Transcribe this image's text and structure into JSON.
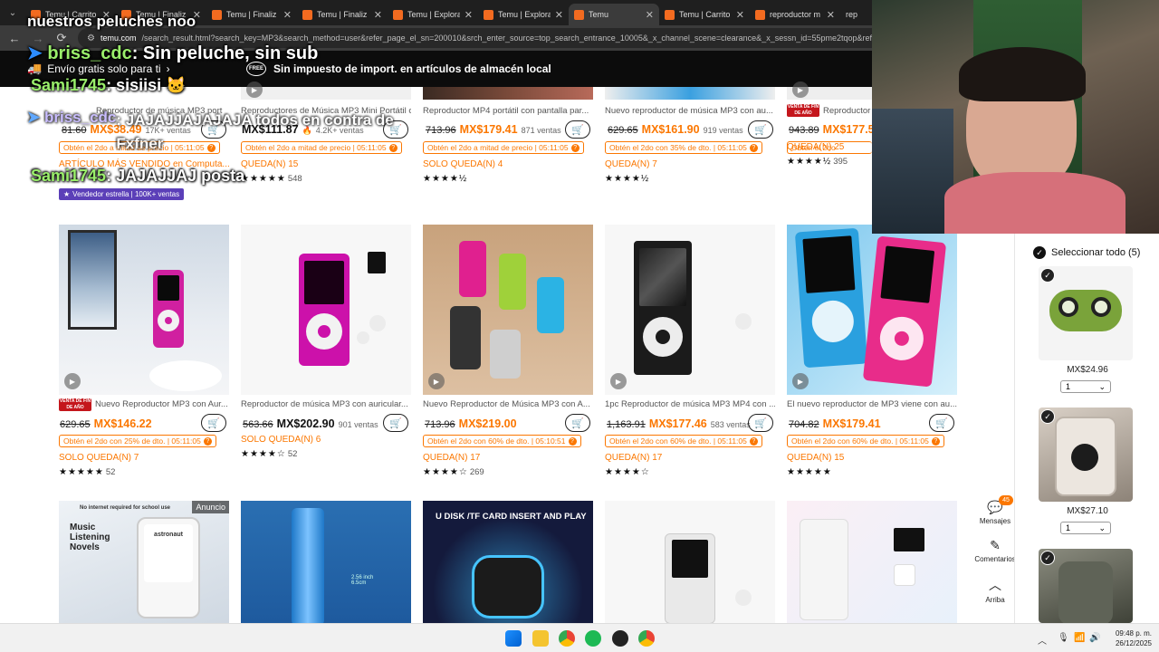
{
  "browser": {
    "tabs": [
      {
        "label": "Temu | Carrito",
        "active": false
      },
      {
        "label": "Temu | Finaliz",
        "active": false
      },
      {
        "label": "Temu | Finaliz",
        "active": false
      },
      {
        "label": "Temu | Finaliz",
        "active": false
      },
      {
        "label": "Temu | Explora",
        "active": false
      },
      {
        "label": "Temu | Explora",
        "active": false
      },
      {
        "label": "Temu",
        "active": true
      },
      {
        "label": "Temu | Carrito",
        "active": false
      },
      {
        "label": "reproductor m",
        "active": false
      },
      {
        "label": "rep",
        "active": false
      }
    ],
    "url_host": "temu.com",
    "url_rest": "/search_result.html?search_key=MP3&search_method=user&refer_page_el_sn=200010&srch_enter_source=top_search_entrance_10005&_x_channel_scene=clearance&_x_sessn_id=55pme2tqop&refe"
  },
  "banner": {
    "shipping": "Envío gratis solo para ti",
    "import_badge": "FREE",
    "import": "Sin impuesto de import. en artículos de almacén local"
  },
  "row1": [
    {
      "title": "Reproductor de música MP3 port",
      "old": "81.60",
      "price": "MX$38.49",
      "sold": "17K+ ventas",
      "promo": "Obtén el 2do a mitad de precio | 05:11:05",
      "stock": "ARTÍCULO MÁS VENDIDO en Computa...",
      "rating_count": "",
      "badge": "VENTA DE FIN DE AÑO",
      "star_seller": "Vendedor estrella | 100K+ ventas"
    },
    {
      "title": "Reproductores de Música MP3 Mini Portátil c...",
      "old": "",
      "price": "MX$111.87",
      "sold": "4.2K+ ventas",
      "promo": "Obtén el 2do a mitad de precio | 05:11:05",
      "stock": "QUEDA(N) 15",
      "rating_count": "548"
    },
    {
      "title": "Reproductor MP4 portátil con pantalla par...",
      "old": "713.96",
      "price": "MX$179.41",
      "sold": "871 ventas",
      "promo": "Obtén el 2do a mitad de precio | 05:11:05",
      "stock": "SOLO QUEDA(N) 4",
      "rating_count": ""
    },
    {
      "title": "Nuevo reproductor de música MP3 con au...",
      "old": "629.65",
      "price": "MX$161.90",
      "sold": "919 ventas",
      "promo": "Obtén el 2do con 35% de dto. | 05:11:05",
      "stock": "QUEDA(N) 7",
      "rating_count": ""
    },
    {
      "title": "Reproductor",
      "old": "943.89",
      "price": "MX$177.5",
      "sold": "",
      "promo": "Obtén el 2do",
      "stock": "QUEDA(N) 25",
      "rating_count": "395",
      "badge": "VENTA DE FIN DE AÑO"
    }
  ],
  "row2": [
    {
      "title": "Nuevo Reproductor MP3 con Aur...",
      "old": "629.65",
      "price": "MX$146.22",
      "sold": "",
      "promo": "Obtén el 2do con 25% de dto. | 05:11:05",
      "stock": "SOLO QUEDA(N) 7",
      "rating_count": "52",
      "stars": "★★★★★",
      "badge": "VENTA DE FIN DE AÑO"
    },
    {
      "title": "Reproductor de música MP3 con auricular...",
      "old": "563.66",
      "price": "MX$202.90",
      "sold": "901 ventas",
      "promo": "",
      "stock": "SOLO QUEDA(N) 6",
      "rating_count": "52",
      "stars": "★★★★☆"
    },
    {
      "title": "Nuevo Reproductor de Música MP3 con A...",
      "old": "713.96",
      "price": "MX$219.00",
      "sold": "",
      "promo": "Obtén el 2do con 60% de dto. | 05:10:51",
      "stock": "QUEDA(N) 17",
      "rating_count": "269",
      "stars": "★★★★☆"
    },
    {
      "title": "1pc Reproductor de música MP3 MP4 con ...",
      "old": "1,163.91",
      "price": "MX$177.46",
      "sold": "583 ventas",
      "promo": "Obtén el 2do con 60% de dto. | 05:11:05",
      "stock": "QUEDA(N) 17",
      "rating_count": "",
      "stars": "★★★★☆"
    },
    {
      "title": "El nuevo reproductor de MP3 viene con au...",
      "old": "704.82",
      "price": "MX$179.41",
      "sold": "",
      "promo": "Obtén el 2do con 60% de dto. | 05:11:05",
      "stock": "QUEDA(N) 15",
      "rating_count": "",
      "stars": "★★★★★"
    }
  ],
  "row3": [
    {
      "caption": "No internet required for school use",
      "text": "Music Listening Novels",
      "brand": "astronaut",
      "ad": "Anuncio"
    },
    {
      "caption": "2.56 inch 6.5cm"
    },
    {
      "caption": "U DISK /TF CARD INSERT AND PLAY"
    },
    {
      "caption": ""
    },
    {
      "caption": ""
    }
  ],
  "side": {
    "select_all": "Seleccionar todo (5)",
    "items": [
      {
        "price": "MX$24.96",
        "qty": "1"
      },
      {
        "price": "MX$27.10",
        "qty": "1"
      }
    ]
  },
  "rail": {
    "messages_badge": "45",
    "messages": "Mensajes",
    "comments": "Comentarios",
    "top": "Arriba"
  },
  "overlay": {
    "top_line": "nuestros peluches noo",
    "chat": [
      {
        "user": "briss_cdc",
        "msg": ": Sin peluche, sin sub"
      },
      {
        "user": "Sami1745",
        "msg": ": sisiisi"
      },
      {
        "user": "briss_cdc",
        "msg": ": JAJAJJAJAJAJA todos en contra de Fxfner"
      },
      {
        "user": "Sami1745",
        "msg": ": JAJAJJAJ posta"
      }
    ]
  },
  "taskbar": {
    "time": "09:48 p. m.",
    "date": "26/12/2025"
  },
  "colors": {
    "accent": "#fb7701",
    "banner_bg": "#0c0c0c"
  }
}
